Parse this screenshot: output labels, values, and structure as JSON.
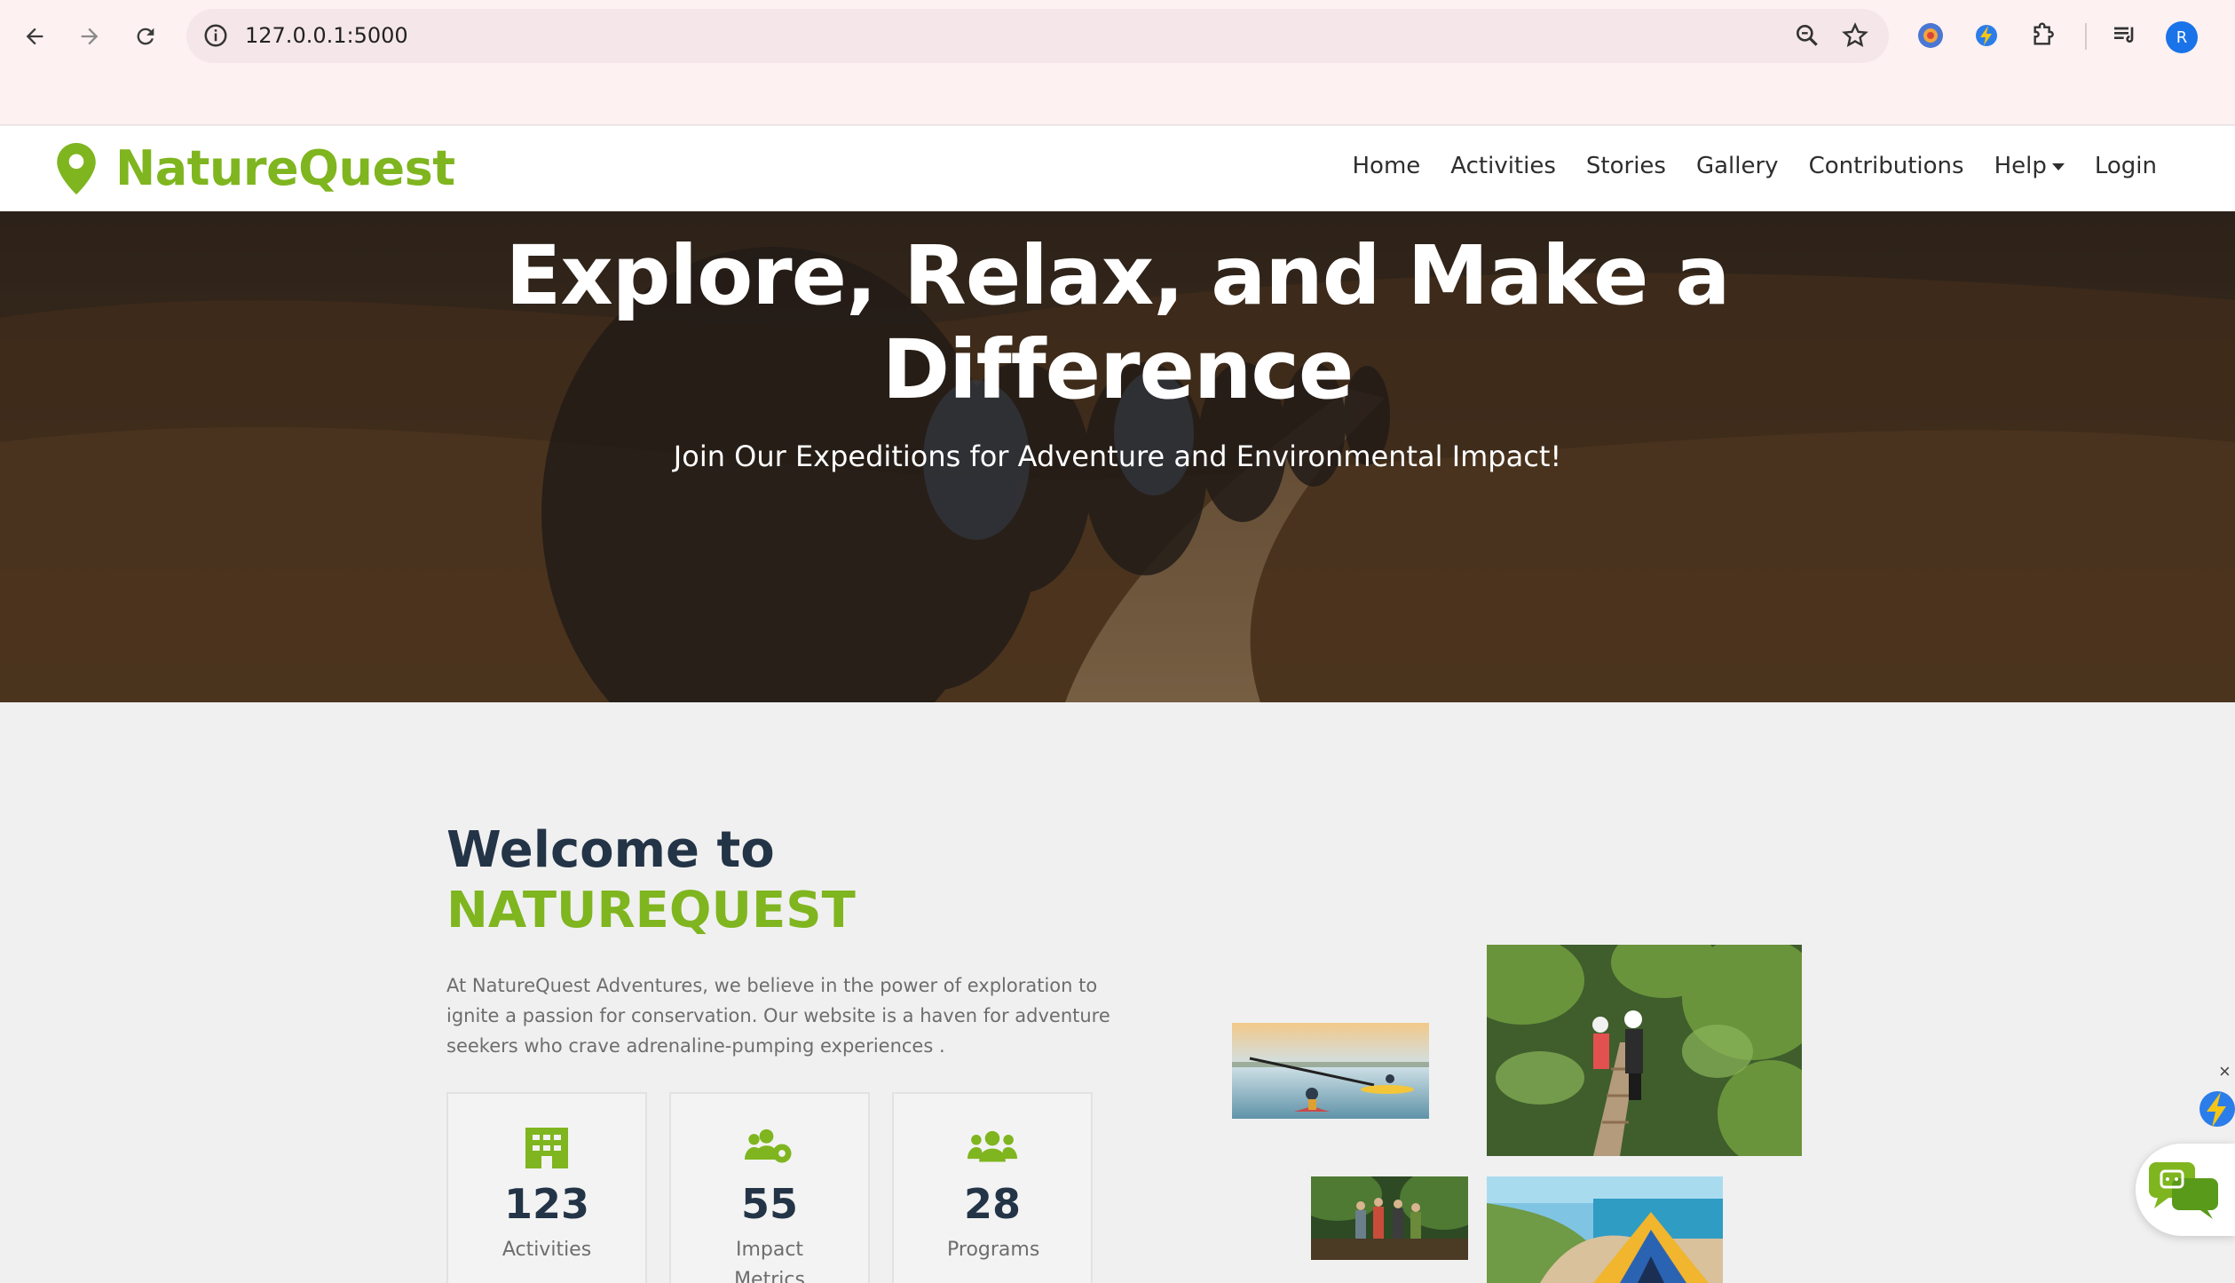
{
  "browser": {
    "url": "127.0.0.1:5000",
    "profile_initial": "R",
    "icons": [
      "back-arrow-icon",
      "forward-arrow-icon",
      "reload-icon",
      "site-info-icon",
      "zoom-icon",
      "bookmark-star-icon",
      "extension-icon",
      "extensions-puzzle-icon",
      "reading-list-icon"
    ]
  },
  "site": {
    "brand": "NatureQuest",
    "brand_color": "#7fb51f",
    "nav": {
      "home": "Home",
      "activities": "Activities",
      "stories": "Stories",
      "gallery": "Gallery",
      "contributions": "Contributions",
      "help": "Help",
      "login": "Login"
    }
  },
  "hero": {
    "title": "Explore, Relax, and Make a Difference",
    "subtitle": "Join Our Expeditions for Adventure and Environmental Impact!"
  },
  "welcome": {
    "heading": "Welcome to",
    "accent": "NATUREQUEST",
    "paragraph": "At NatureQuest Adventures, we believe in the power of exploration to ignite a passion for conservation. Our website is a haven for adventure seekers who crave adrenaline-pumping experiences ."
  },
  "stats": [
    {
      "value": "123",
      "label": "Activities",
      "icon": "building-icon"
    },
    {
      "value": "55",
      "label": "Impact Metrics",
      "icon": "users-cog-icon"
    },
    {
      "value": "28",
      "label": "Programs",
      "icon": "users-group-icon"
    }
  ],
  "gallery": [
    "kayaking-photo",
    "zipline-photo",
    "hiking-photo",
    "beach-tent-photo"
  ],
  "widgets": {
    "close": "×"
  }
}
